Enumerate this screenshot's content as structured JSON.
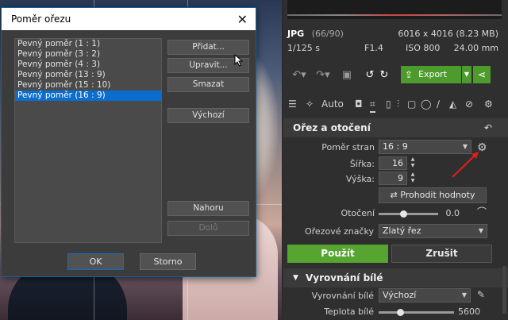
{
  "dialog": {
    "title": "Poměr ořezu",
    "ratios": [
      "Pevný poměr (1 : 1)",
      "Pevný poměr (3 : 2)",
      "Pevný poměr (4 : 3)",
      "Pevný poměr (13 : 9)",
      "Pevný poměr (15 : 10)",
      "Pevný poměr (16 : 9)"
    ],
    "selected_ratio": "Pevný poměr (16 : 9)",
    "buttons": {
      "add": "Přidat...",
      "edit": "Upravit...",
      "delete": "Smazat",
      "default": "Výchozí",
      "up": "Nahoru",
      "down": "Dolů"
    },
    "ok": "OK",
    "cancel": "Storno"
  },
  "panel": {
    "file_type": "JPG",
    "file_counter": "(66/90)",
    "dimensions": "6016 x 4016 (8.23 MB)",
    "shutter": "1/125 s",
    "aperture": "F1.4",
    "iso": "ISO 800",
    "focal": "24.00 mm",
    "export_label": "Export",
    "auto_label": "Auto",
    "crop_section": {
      "title": "Ořez a otočení",
      "aspect_label": "Poměr stran",
      "aspect_value": "16 : 9",
      "width_label": "Šířka:",
      "width_value": "16",
      "height_label": "Výška:",
      "height_value": "9",
      "swap_label": "Prohodit hodnoty",
      "rotation_label": "Otočení",
      "rotation_value": "0.0",
      "marks_label": "Ořezové značky",
      "marks_value": "Zlatý řez",
      "apply": "Použít",
      "cancel": "Zrušit"
    },
    "wb_section": {
      "title": "Vyrovnání bílé",
      "wb_label": "Vyrovnání bílé",
      "wb_value": "Výchozí",
      "temp_label": "Teplota bílé",
      "temp_value": "5600"
    }
  },
  "colors": {
    "accent_green": "#56a530",
    "selection_blue": "#0b6ecf",
    "dialog_border": "#0a64a8"
  }
}
